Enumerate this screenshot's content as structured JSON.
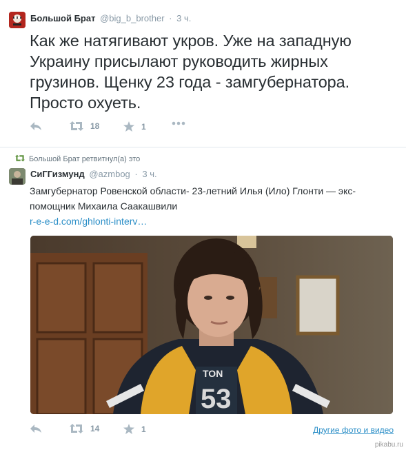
{
  "tweet1": {
    "author_name": "Большой Брат",
    "author_handle": "@big_b_brother",
    "separator": "·",
    "time": "3 ч.",
    "text": "Как же натягивают укров. Уже на западную Украину присылают руководить жирных грузинов. Щенку 23 года - замгубернатора. Просто охуеть.",
    "retweets": "18",
    "favorites": "1"
  },
  "retweet_notice": "Большой Брат ретвитнул(а) это",
  "tweet2": {
    "author_name": "СиГГизмунд",
    "author_handle": "@azmbog",
    "separator": "·",
    "time": "3 ч.",
    "text": "Замгубернатор Ровенской области- 23-летний Илья (Ило) Глонти — экс-помощник Михаила Саакашвили",
    "link": "r-e-e-d.com/ghlonti-interv…",
    "retweets": "14",
    "favorites": "1",
    "more_media": "Другие фото и видео"
  },
  "watermark": "pikabu.ru",
  "icons": {
    "reply": "reply-icon",
    "retweet": "retweet-icon",
    "favorite": "star-icon",
    "more": "more-dots-icon"
  },
  "colors": {
    "link": "#2a8ec7",
    "muted": "#8899a6",
    "text": "#292f33",
    "retweet_green": "#5c913b"
  }
}
